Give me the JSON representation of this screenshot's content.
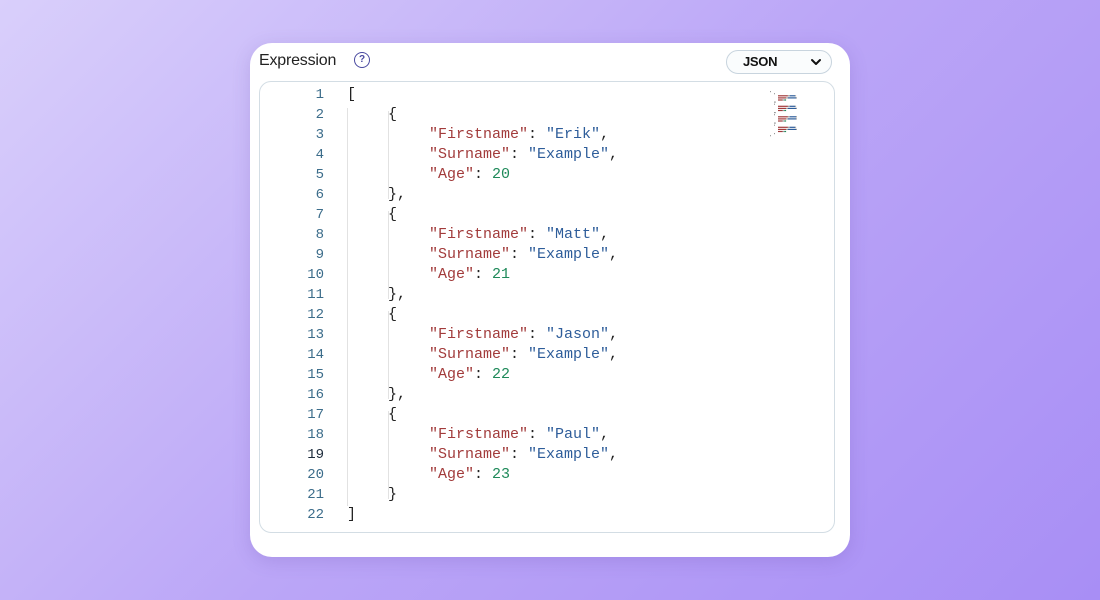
{
  "panel": {
    "title": "Expression",
    "help_icon": "question-circle-icon",
    "format_select": {
      "selected": "JSON",
      "icon": "chevron-down-icon"
    }
  },
  "editor": {
    "active_line": 19,
    "colors": {
      "key": "#a23b3b",
      "string": "#2e5d9a",
      "number": "#1f8a5a",
      "line_number": "#3b6c8a"
    },
    "lines": [
      {
        "n": "1",
        "indent": 0,
        "tokens": [
          {
            "t": "punc",
            "v": "["
          }
        ]
      },
      {
        "n": "2",
        "indent": 1,
        "tokens": [
          {
            "t": "punc",
            "v": "{"
          }
        ]
      },
      {
        "n": "3",
        "indent": 2,
        "tokens": [
          {
            "t": "key",
            "v": "\"Firstname\""
          },
          {
            "t": "punc",
            "v": ": "
          },
          {
            "t": "str",
            "v": "\"Erik\""
          },
          {
            "t": "punc",
            "v": ","
          }
        ]
      },
      {
        "n": "4",
        "indent": 2,
        "tokens": [
          {
            "t": "key",
            "v": "\"Surname\""
          },
          {
            "t": "punc",
            "v": ": "
          },
          {
            "t": "str",
            "v": "\"Example\""
          },
          {
            "t": "punc",
            "v": ","
          }
        ]
      },
      {
        "n": "5",
        "indent": 2,
        "tokens": [
          {
            "t": "key",
            "v": "\"Age\""
          },
          {
            "t": "punc",
            "v": ": "
          },
          {
            "t": "num",
            "v": "20"
          }
        ]
      },
      {
        "n": "6",
        "indent": 1,
        "tokens": [
          {
            "t": "punc",
            "v": "},"
          }
        ]
      },
      {
        "n": "7",
        "indent": 1,
        "tokens": [
          {
            "t": "punc",
            "v": "{"
          }
        ]
      },
      {
        "n": "8",
        "indent": 2,
        "tokens": [
          {
            "t": "key",
            "v": "\"Firstname\""
          },
          {
            "t": "punc",
            "v": ": "
          },
          {
            "t": "str",
            "v": "\"Matt\""
          },
          {
            "t": "punc",
            "v": ","
          }
        ]
      },
      {
        "n": "9",
        "indent": 2,
        "tokens": [
          {
            "t": "key",
            "v": "\"Surname\""
          },
          {
            "t": "punc",
            "v": ": "
          },
          {
            "t": "str",
            "v": "\"Example\""
          },
          {
            "t": "punc",
            "v": ","
          }
        ]
      },
      {
        "n": "10",
        "indent": 2,
        "tokens": [
          {
            "t": "key",
            "v": "\"Age\""
          },
          {
            "t": "punc",
            "v": ": "
          },
          {
            "t": "num",
            "v": "21"
          }
        ]
      },
      {
        "n": "11",
        "indent": 1,
        "tokens": [
          {
            "t": "punc",
            "v": "},"
          }
        ]
      },
      {
        "n": "12",
        "indent": 1,
        "tokens": [
          {
            "t": "punc",
            "v": "{"
          }
        ]
      },
      {
        "n": "13",
        "indent": 2,
        "tokens": [
          {
            "t": "key",
            "v": "\"Firstname\""
          },
          {
            "t": "punc",
            "v": ": "
          },
          {
            "t": "str",
            "v": "\"Jason\""
          },
          {
            "t": "punc",
            "v": ","
          }
        ]
      },
      {
        "n": "14",
        "indent": 2,
        "tokens": [
          {
            "t": "key",
            "v": "\"Surname\""
          },
          {
            "t": "punc",
            "v": ": "
          },
          {
            "t": "str",
            "v": "\"Example\""
          },
          {
            "t": "punc",
            "v": ","
          }
        ]
      },
      {
        "n": "15",
        "indent": 2,
        "tokens": [
          {
            "t": "key",
            "v": "\"Age\""
          },
          {
            "t": "punc",
            "v": ": "
          },
          {
            "t": "num",
            "v": "22"
          }
        ]
      },
      {
        "n": "16",
        "indent": 1,
        "tokens": [
          {
            "t": "punc",
            "v": "},"
          }
        ]
      },
      {
        "n": "17",
        "indent": 1,
        "tokens": [
          {
            "t": "punc",
            "v": "{"
          }
        ]
      },
      {
        "n": "18",
        "indent": 2,
        "tokens": [
          {
            "t": "key",
            "v": "\"Firstname\""
          },
          {
            "t": "punc",
            "v": ": "
          },
          {
            "t": "str",
            "v": "\"Paul\""
          },
          {
            "t": "punc",
            "v": ","
          }
        ]
      },
      {
        "n": "19",
        "indent": 2,
        "tokens": [
          {
            "t": "key",
            "v": "\"Surname\""
          },
          {
            "t": "punc",
            "v": ": "
          },
          {
            "t": "str",
            "v": "\"Example\""
          },
          {
            "t": "punc",
            "v": ","
          }
        ]
      },
      {
        "n": "20",
        "indent": 2,
        "tokens": [
          {
            "t": "key",
            "v": "\"Age\""
          },
          {
            "t": "punc",
            "v": ": "
          },
          {
            "t": "num",
            "v": "23"
          }
        ]
      },
      {
        "n": "21",
        "indent": 1,
        "tokens": [
          {
            "t": "punc",
            "v": "}"
          }
        ]
      },
      {
        "n": "22",
        "indent": 0,
        "tokens": [
          {
            "t": "punc",
            "v": "]"
          }
        ]
      }
    ]
  }
}
